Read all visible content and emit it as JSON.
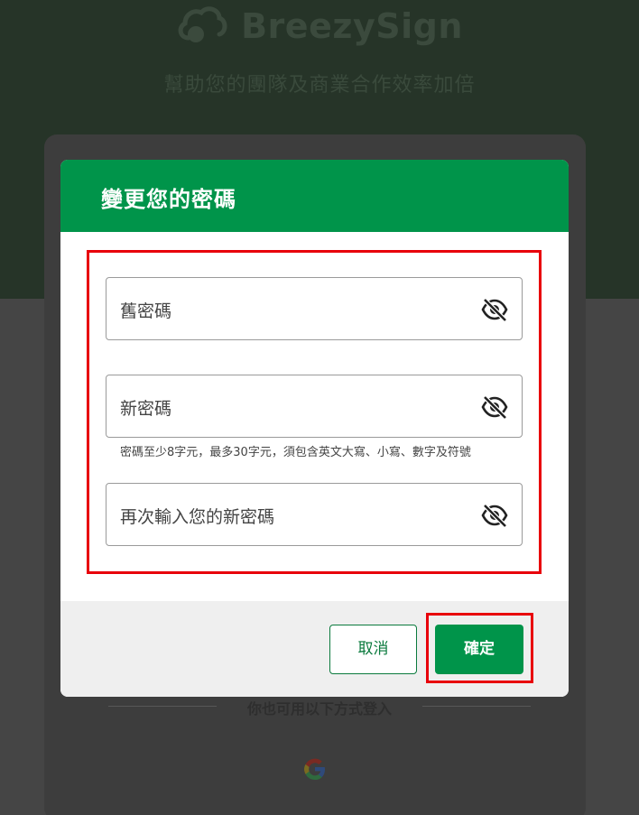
{
  "background": {
    "brand_name": "BreezySign",
    "tagline": "幫助您的團隊及商業合作效率加倍",
    "alt_login_text": "你也可用以下方式登入",
    "google_icon": "google-icon"
  },
  "dialog": {
    "title": "變更您的密碼",
    "fields": [
      {
        "label": "舊密碼",
        "icon": "eye-off-icon"
      },
      {
        "label": "新密碼",
        "icon": "eye-off-icon"
      },
      {
        "label": "再次輸入您的新密碼",
        "icon": "eye-off-icon"
      }
    ],
    "password_hint": "密碼至少8字元，最多30字元，須包含英文大寫、小寫、數字及符號",
    "cancel_label": "取消",
    "confirm_label": "確定"
  },
  "colors": {
    "accent": "#00944a",
    "highlight": "#e8000b"
  }
}
